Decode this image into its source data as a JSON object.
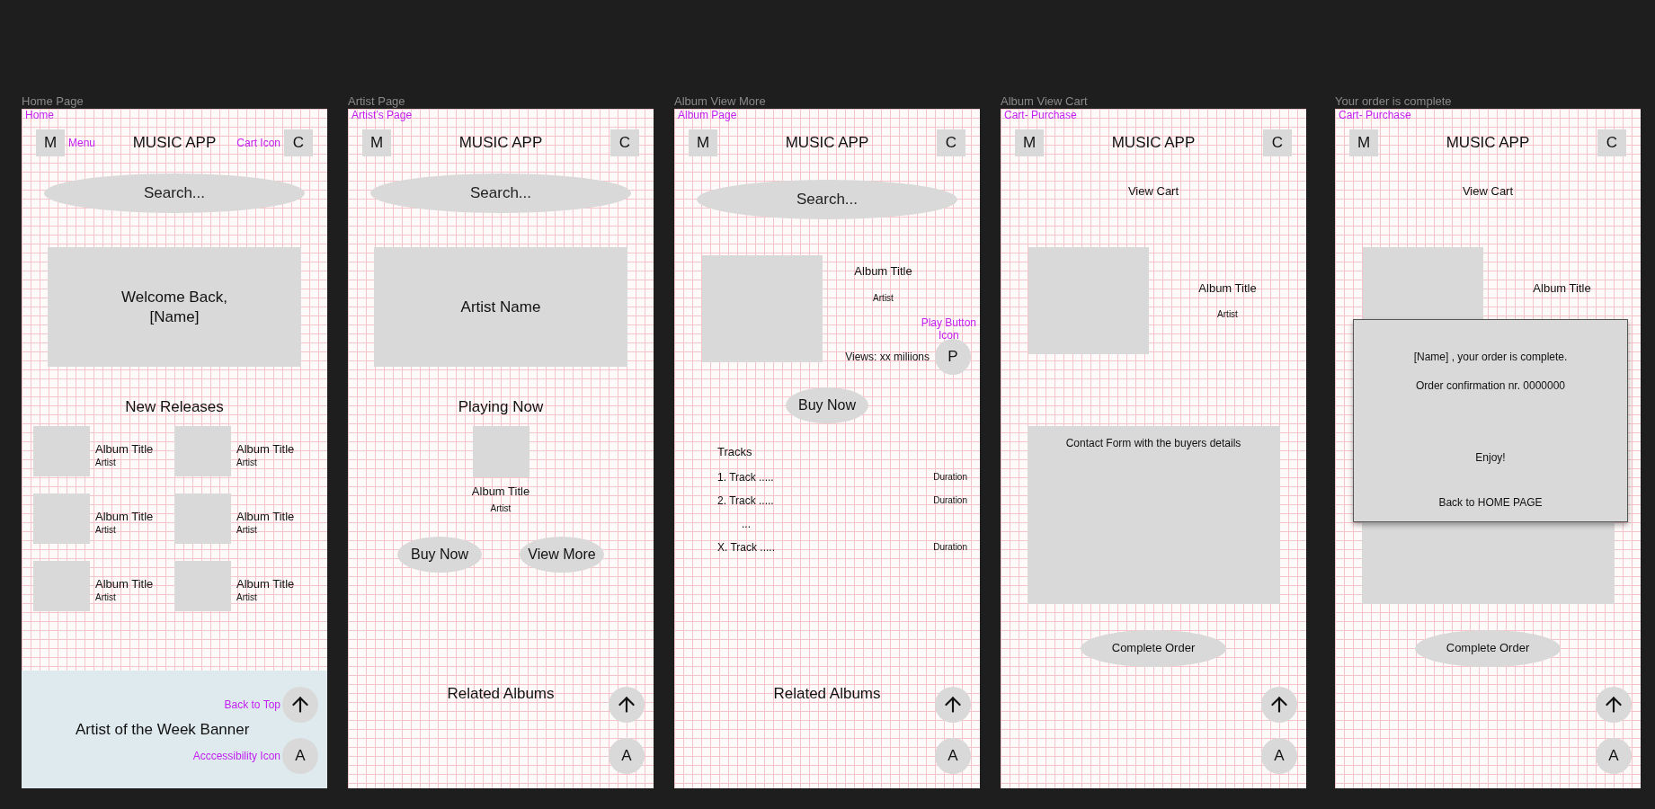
{
  "canvas": {
    "frames": [
      {
        "kind": "home",
        "title": "Home Page",
        "annotation": "Home",
        "header": {
          "menu_key": "M",
          "menu_note": "Menu",
          "app_title": "MUSIC APP",
          "cart_note": "Cart Icon",
          "cart_key": "C"
        },
        "search": {
          "placeholder": "Search..."
        },
        "hero": "Welcome Back,\n[Name]",
        "section_title": "New Releases",
        "albums": [
          {
            "title": "Album Title",
            "artist": "Artist"
          },
          {
            "title": "Album Title",
            "artist": "Artist"
          },
          {
            "title": "Album Title",
            "artist": "Artist"
          },
          {
            "title": "Album Title",
            "artist": "Artist"
          },
          {
            "title": "Album Title",
            "artist": "Artist"
          },
          {
            "title": "Album Title",
            "artist": "Artist"
          }
        ],
        "banner": "Artist of the Week Banner",
        "fabs": {
          "top_note": "Back to Top",
          "accessibility_note": "Acccessibility Icon",
          "accessibility_key": "A"
        }
      },
      {
        "kind": "artist",
        "title": "Artist Page",
        "annotation": "Artist’s Page",
        "header": {
          "menu_key": "M",
          "app_title": "MUSIC APP",
          "cart_key": "C"
        },
        "search": {
          "placeholder": "Search..."
        },
        "hero": "Artist Name",
        "section_title": "Playing Now",
        "now_playing": {
          "title": "Album Title",
          "artist": "Artist"
        },
        "buttons": [
          "Buy Now",
          "View More"
        ],
        "footer_title": "Related Albums",
        "fabs": {
          "accessibility_key": "A"
        }
      },
      {
        "kind": "album",
        "title": "Album View More",
        "annotation": "Album Page",
        "header": {
          "menu_key": "M",
          "app_title": "MUSIC APP",
          "cart_key": "C"
        },
        "search": {
          "placeholder": "Search..."
        },
        "album": {
          "title": "Album Title",
          "artist": "Artist",
          "views": "Views: xx miliions",
          "play_key": "P",
          "play_note": "Play Button\nIcon"
        },
        "buy_button": "Buy Now",
        "tracks_title": "Tracks",
        "tracks": [
          {
            "name": "1. Track .....",
            "duration": "Duration"
          },
          {
            "name": "2. Track .....",
            "duration": "Duration"
          },
          {
            "name": "..."
          },
          {
            "name": "X. Track .....",
            "duration": "Duration"
          }
        ],
        "footer_title": "Related Albums",
        "fabs": {
          "accessibility_key": "A"
        }
      },
      {
        "kind": "cart",
        "title": "Album View Cart",
        "annotation": "Cart- Purchase",
        "header": {
          "menu_key": "M",
          "app_title": "MUSIC APP",
          "cart_key": "C"
        },
        "heading": "View Cart",
        "album": {
          "title": "Album Title",
          "artist": "Artist"
        },
        "form": "Contact Form with the buyers details",
        "order_button": "Complete Order",
        "fabs": {
          "accessibility_key": "A"
        }
      },
      {
        "kind": "cart",
        "title": "Your order is complete",
        "annotation": "Cart- Purchase",
        "header": {
          "menu_key": "M",
          "app_title": "MUSIC APP",
          "cart_key": "C"
        },
        "heading": "View Cart",
        "album": {
          "title": "Album Title"
        },
        "order_button": "Complete Order",
        "fabs": {
          "accessibility_key": "A"
        },
        "dialog": {
          "message": "[Name] , your order is complete.",
          "confirmation": "Order confirmation nr. 0000000",
          "closing": "Enjoy!",
          "link": "Back to HOME PAGE"
        }
      }
    ]
  }
}
